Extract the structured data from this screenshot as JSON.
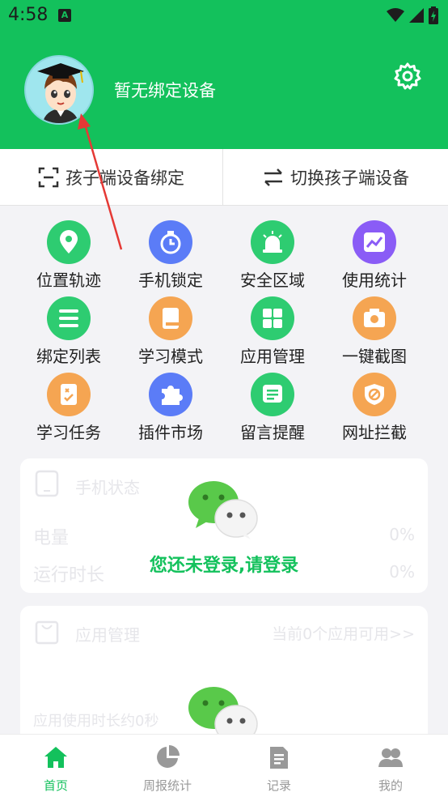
{
  "status_bar": {
    "time": "4:58",
    "notification_badge": "A"
  },
  "header": {
    "bind_status": "暂无绑定设备",
    "settings_icon": "gear-icon",
    "background": "#13c15c"
  },
  "bind_bar": {
    "bind_label": "孩子端设备绑定",
    "switch_label": "切换孩子端设备"
  },
  "features": [
    {
      "label": "位置轨迹",
      "icon": "location-pin-icon",
      "color": "#2ecc71"
    },
    {
      "label": "手机锁定",
      "icon": "timer-icon",
      "color": "#5b7cf7"
    },
    {
      "label": "安全区域",
      "icon": "alarm-lamp-icon",
      "color": "#2ecc71"
    },
    {
      "label": "使用统计",
      "icon": "trend-chart-icon",
      "color": "#8a5cf6"
    },
    {
      "label": "绑定列表",
      "icon": "list-icon",
      "color": "#2ecc71"
    },
    {
      "label": "学习模式",
      "icon": "book-icon",
      "color": "#f5a552"
    },
    {
      "label": "应用管理",
      "icon": "app-grid-icon",
      "color": "#2ecc71"
    },
    {
      "label": "一键截图",
      "icon": "camera-icon",
      "color": "#f5a552"
    },
    {
      "label": "学习任务",
      "icon": "task-checklist-icon",
      "color": "#f5a552"
    },
    {
      "label": "插件市场",
      "icon": "puzzle-icon",
      "color": "#5b7cf7"
    },
    {
      "label": "留言提醒",
      "icon": "message-icon",
      "color": "#2ecc71"
    },
    {
      "label": "网址拦截",
      "icon": "block-shield-icon",
      "color": "#f5a552"
    }
  ],
  "phone_status_card": {
    "title": "手机状态",
    "battery_label": "电量",
    "battery_value": "0%",
    "runtime_label": "运行时长",
    "runtime_value": "0%",
    "login_message": "您还未登录,请登录"
  },
  "app_manage_card": {
    "title": "应用管理",
    "available": "当前0个应用可用>>",
    "usage": "应用使用时长约0秒"
  },
  "bottom_nav": [
    {
      "label": "首页",
      "icon": "home-icon",
      "active": true
    },
    {
      "label": "周报统计",
      "icon": "pie-chart-icon",
      "active": false
    },
    {
      "label": "记录",
      "icon": "document-icon",
      "active": false
    },
    {
      "label": "我的",
      "icon": "users-icon",
      "active": false
    }
  ],
  "colors": {
    "accent": "#13c15c",
    "annotation_arrow": "#e53935"
  }
}
